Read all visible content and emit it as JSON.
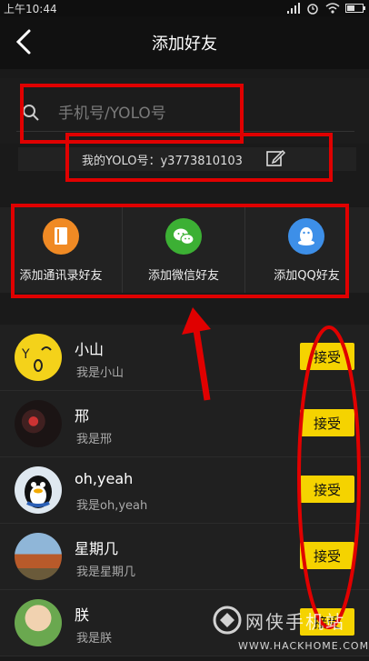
{
  "status_bar": {
    "time": "上午10:44",
    "battery_level": 0.5
  },
  "nav": {
    "title": "添加好友"
  },
  "search": {
    "placeholder": "手机号/YOLO号"
  },
  "yolo": {
    "label": "我的YOLO号：y3773810103"
  },
  "actions": [
    {
      "label": "添加通讯录好友",
      "icon": "contacts-book-icon",
      "color": "#f08a24"
    },
    {
      "label": "添加微信好友",
      "icon": "wechat-icon",
      "color": "#3cb034"
    },
    {
      "label": "添加QQ好友",
      "icon": "qq-penguin-icon",
      "color": "#3d8fe8"
    }
  ],
  "friends": [
    {
      "name": "小山",
      "message": "我是小山",
      "button": "接受"
    },
    {
      "name": "邢",
      "message": "我是邢",
      "button": "接受"
    },
    {
      "name": "oh,yeah",
      "message": "我是oh,yeah",
      "button": "接受"
    },
    {
      "name": "星期几",
      "message": "我是星期几",
      "button": "接受"
    },
    {
      "name": "朕",
      "message": "我是朕",
      "button": "接受"
    }
  ],
  "watermark": {
    "text": "网侠手机站",
    "url": "WWW.HACKHOME.COM"
  },
  "colors": {
    "accent": "#f5d300",
    "annotation": "#e00000"
  }
}
